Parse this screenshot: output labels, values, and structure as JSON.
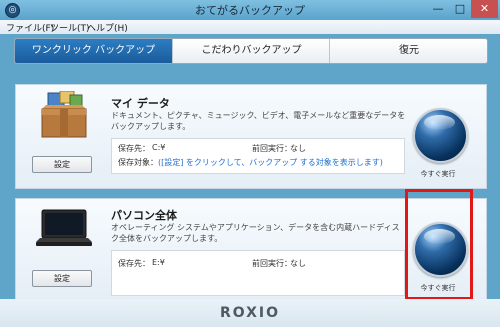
{
  "window": {
    "title": "おてがるバックアップ",
    "min": "—",
    "max": "□",
    "close": "✕",
    "app_icon": "◎"
  },
  "menu": [
    "ファイル(F)",
    "ツール(T)",
    "ヘルプ(H)"
  ],
  "tabs": [
    "ワンクリック バックアップ",
    "こだわりバックアップ",
    "復元"
  ],
  "panels": {
    "my_data": {
      "title": "マイ データ",
      "description": "ドキュメント、ピクチャ、ミュージック、ビデオ、電子メールなど重要なデータをバックアップします。",
      "dest_label": "保存先：",
      "dest_value": "C:¥",
      "last_label": "前回実行：",
      "last_value": "なし",
      "target_label": "保存対象：",
      "target_value": "([設定] をクリックして、バックアップ する対象を表示します)",
      "settings_button": "設定",
      "run_label": "今すぐ実行",
      "icon": "box-icon"
    },
    "whole_pc": {
      "title": "パソコン全体",
      "description": "オペレーティング システムやアプリケーション、データを含む内蔵ハードディスク全体をバックアップします。",
      "dest_label": "保存先：",
      "dest_value": "E:¥",
      "last_label": "前回実行：",
      "last_value": "なし",
      "settings_button": "設定",
      "run_label": "今すぐ実行",
      "icon": "laptop-icon"
    }
  },
  "footer": {
    "logo": "ROXIO"
  },
  "colors": {
    "accent": "#1a5c9c",
    "highlight": "#e01818"
  }
}
